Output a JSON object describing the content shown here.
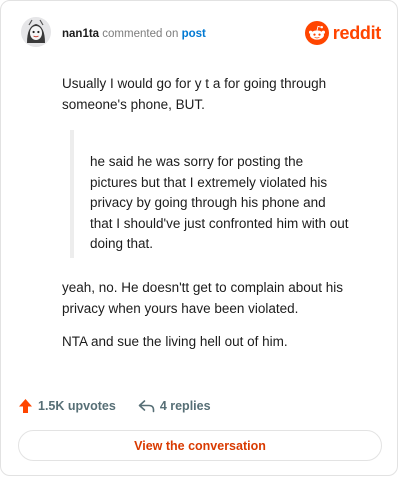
{
  "header": {
    "username": "nan1ta",
    "action_text": "commented on",
    "post_link": "post",
    "brand_text": "reddit"
  },
  "comment": {
    "paragraph_1": "Usually I would go for y t a for going through someone's phone, BUT.",
    "quote": "he said he was sorry for posting the pictures but that I extremely violated his privacy by going through his phone and that I should've just confronted him with out doing that.",
    "paragraph_2": "yeah, no. He doesn'tt get to complain about his privacy when yours have been violated.",
    "paragraph_3": "NTA and sue the living hell out of him."
  },
  "stats": {
    "upvotes": "1.5K upvotes",
    "replies": "4 replies"
  },
  "cta": {
    "label": "View the conversation"
  },
  "colors": {
    "brand": "#ff4500",
    "link": "#0079d3",
    "cta_text": "#d93a00",
    "stat_text": "#576f76"
  },
  "icons": {
    "avatar": "avatar-icon",
    "brand": "reddit-logo-icon",
    "upvote": "upvote-arrow-icon",
    "reply": "reply-arrow-icon"
  }
}
